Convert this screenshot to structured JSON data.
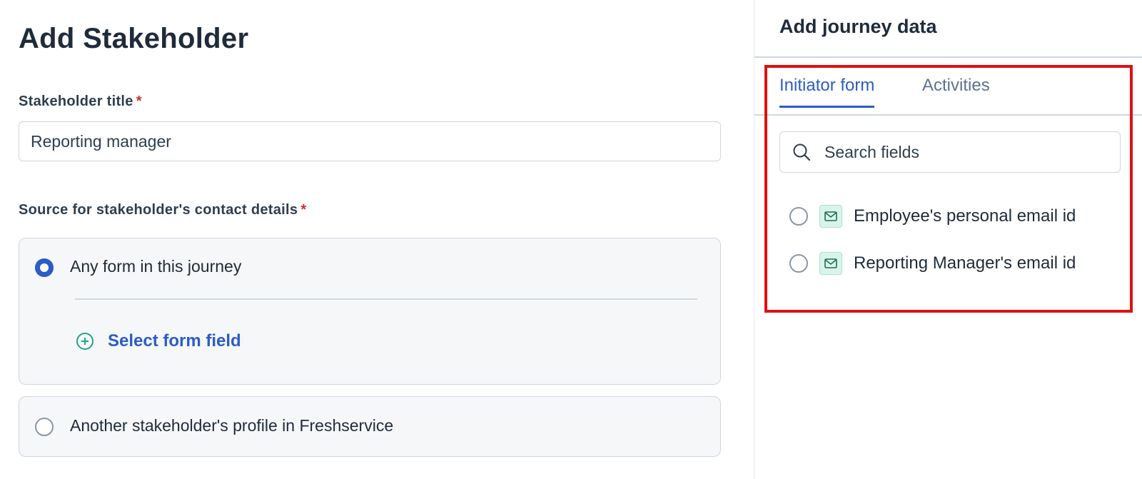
{
  "form": {
    "title": "Add Stakeholder",
    "stakeholder_title": {
      "label": "Stakeholder title",
      "required_mark": "*",
      "value": "Reporting manager"
    },
    "source": {
      "label": "Source for stakeholder's contact details",
      "required_mark": "*",
      "options": [
        {
          "label": "Any form in this journey",
          "checked": true,
          "action_label": "Select form field"
        },
        {
          "label": "Another stakeholder's profile in Freshservice",
          "checked": false
        }
      ]
    }
  },
  "panel": {
    "title": "Add journey data",
    "tabs": [
      {
        "label": "Initiator form",
        "active": true
      },
      {
        "label": "Activities",
        "active": false
      }
    ],
    "search": {
      "placeholder": "Search fields",
      "icon": "search-icon"
    },
    "fields": [
      {
        "label": "Employee's personal email id",
        "icon": "email-icon",
        "checked": false
      },
      {
        "label": "Reporting Manager's email id",
        "icon": "email-icon",
        "checked": false
      }
    ]
  },
  "colors": {
    "accent": "#2c5cc5",
    "required": "#d12d2d",
    "highlight": "#e01010",
    "success_icon": "#27a47a"
  }
}
